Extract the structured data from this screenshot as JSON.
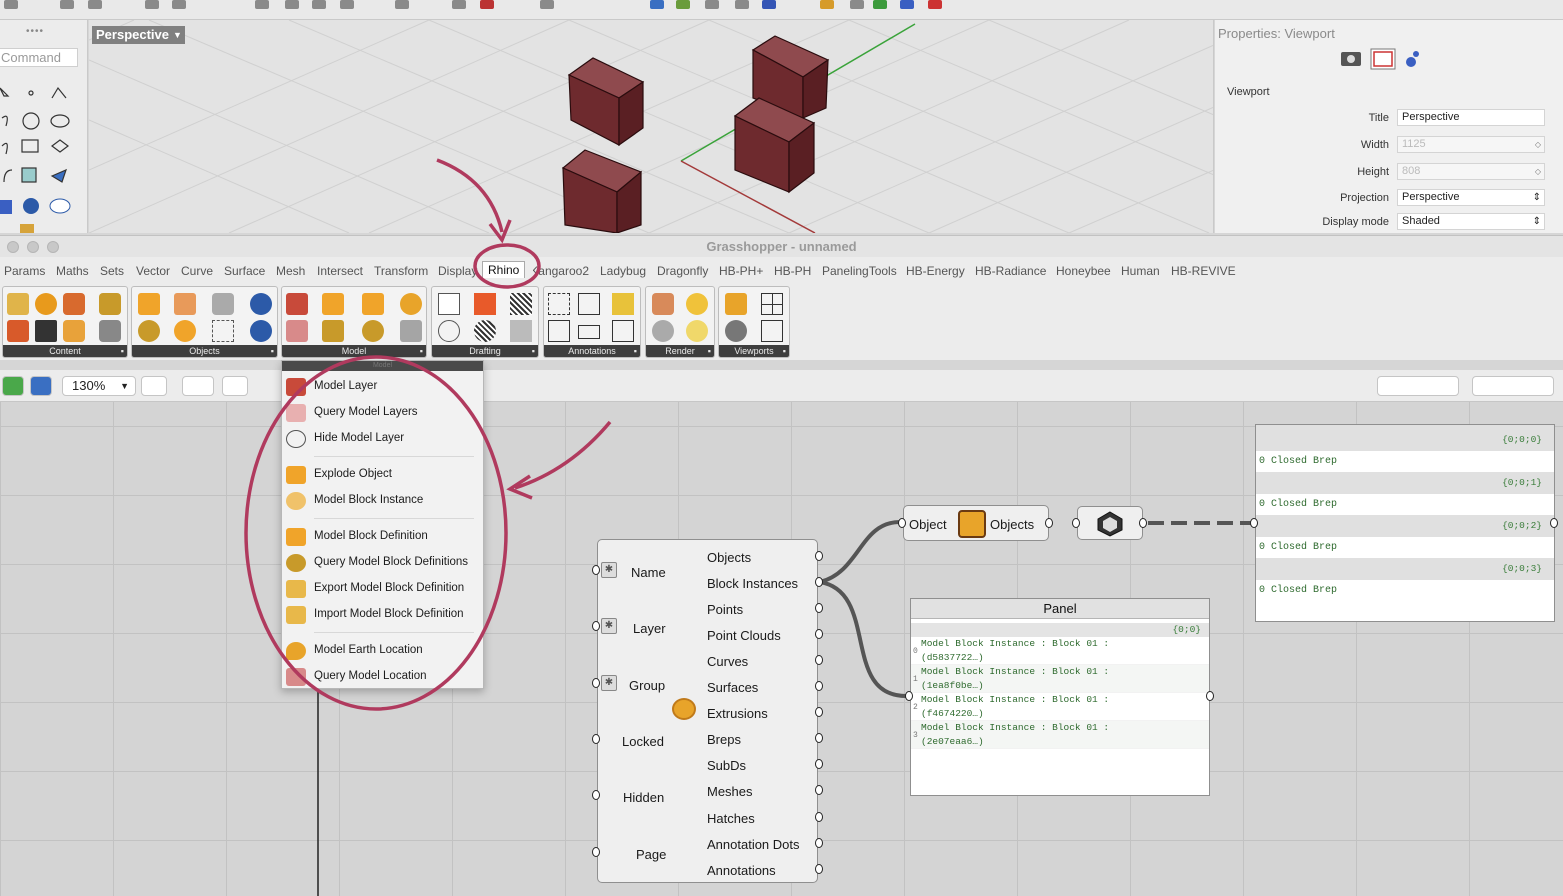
{
  "rhino": {
    "command_placeholder": "Command",
    "viewport_label": "Perspective",
    "properties": {
      "title": "Properties: Viewport",
      "section": "Viewport",
      "rows": [
        {
          "label": "Title",
          "value": "Perspective"
        },
        {
          "label": "Width",
          "value": "1125"
        },
        {
          "label": "Height",
          "value": "808"
        },
        {
          "label": "Projection",
          "value": "Perspective"
        },
        {
          "label": "Display mode",
          "value": "Shaded"
        }
      ]
    }
  },
  "grasshopper": {
    "window_title": "Grasshopper - unnamed",
    "tabs": [
      "Params",
      "Maths",
      "Sets",
      "Vector",
      "Curve",
      "Surface",
      "Mesh",
      "Intersect",
      "Transform",
      "Display",
      "Rhino",
      "Kangaroo2",
      "Ladybug",
      "Dragonfly",
      "HB-PH+",
      "HB-PH",
      "PanelingTools",
      "HB-Energy",
      "HB-Radiance",
      "Honeybee",
      "Human",
      "HB-REVIVE"
    ],
    "active_tab": "Rhino",
    "ribbon_groups": [
      "Content",
      "Objects",
      "Model",
      "Drafting",
      "Annotations",
      "Render",
      "Viewports"
    ],
    "zoom": "130%",
    "dropdown": {
      "header": "Model",
      "items": [
        "Model Layer",
        "Query Model Layers",
        "Hide Model Layer",
        "Explode Object",
        "Model Block Instance",
        "Model Block Definition",
        "Query Model Block Definitions",
        "Export Model Block Definition",
        "Import Model Block Definition",
        "Model Earth Location",
        "Query Model Location"
      ]
    },
    "query_component": {
      "inputs": [
        "Name",
        "Layer",
        "Group",
        "Locked",
        "Hidden",
        "Page"
      ],
      "outputs": [
        "Objects",
        "Block Instances",
        "Points",
        "Point Clouds",
        "Curves",
        "Surfaces",
        "Extrusions",
        "Breps",
        "SubDs",
        "Meshes",
        "Hatches",
        "Annotation Dots",
        "Annotations"
      ]
    },
    "explode_component": {
      "input": "Object",
      "output": "Objects"
    },
    "panel": {
      "title": "Panel",
      "path": "{0;0}",
      "rows": [
        {
          "index": "0",
          "line1": "Model Block Instance : Block 01 :",
          "line2": "(d5837722…)"
        },
        {
          "index": "1",
          "line1": "Model Block Instance : Block 01 :",
          "line2": "(1ea8f0be…)"
        },
        {
          "index": "2",
          "line1": "Model Block Instance : Block 01 :",
          "line2": "(f4674220…)"
        },
        {
          "index": "3",
          "line1": "Model Block Instance : Block 01 :",
          "line2": "(2e07eaa6…)"
        }
      ]
    },
    "brep_panel": {
      "groups": [
        {
          "path": "{0;0;0}",
          "index": "0",
          "value": "Closed Brep"
        },
        {
          "path": "{0;0;1}",
          "index": "0",
          "value": "Closed Brep"
        },
        {
          "path": "{0;0;2}",
          "index": "0",
          "value": "Closed Brep"
        },
        {
          "path": "{0;0;3}",
          "index": "0",
          "value": "Closed Brep"
        }
      ]
    }
  },
  "colors": {
    "annotation": "#b03a5e",
    "cube": "#6e2a2e",
    "wire": "#555555"
  }
}
